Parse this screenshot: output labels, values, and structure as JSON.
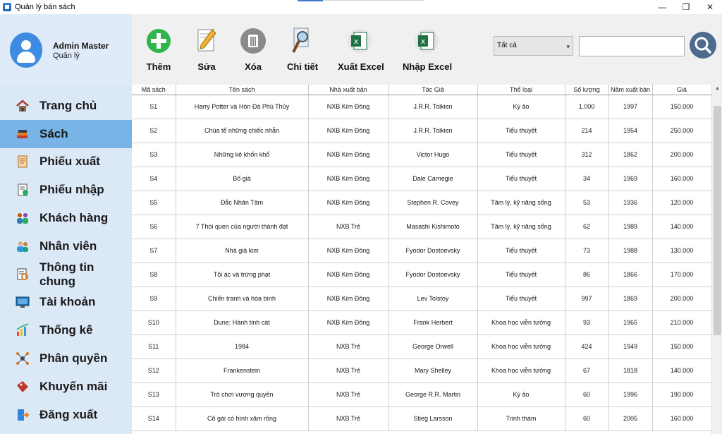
{
  "window": {
    "title": "Quản lý bán sách",
    "minimize": "—",
    "maximize": "❐",
    "close": "✕"
  },
  "profile": {
    "name": "Admin Master",
    "role": "Quản lý"
  },
  "nav": [
    {
      "label": "Trang chủ",
      "icon": "home-icon"
    },
    {
      "label": "Sách",
      "icon": "books-icon",
      "active": true
    },
    {
      "label": "Phiếu xuất",
      "icon": "export-receipt-icon"
    },
    {
      "label": "Phiếu nhập",
      "icon": "import-receipt-icon"
    },
    {
      "label": "Khách hàng",
      "icon": "customers-icon"
    },
    {
      "label": "Nhân viên",
      "icon": "employees-icon"
    },
    {
      "label": "Thông tin chung",
      "icon": "info-icon"
    },
    {
      "label": "Tài khoản",
      "icon": "account-icon"
    },
    {
      "label": "Thống kê",
      "icon": "statistics-icon"
    },
    {
      "label": "Phân quyền",
      "icon": "permissions-icon"
    },
    {
      "label": "Khuyến mãi",
      "icon": "promotion-icon"
    },
    {
      "label": "Đăng xuất",
      "icon": "logout-icon"
    }
  ],
  "toolbar": {
    "add": "Thêm",
    "edit": "Sửa",
    "delete": "Xóa",
    "detail": "Chi tiết",
    "export_excel": "Xuất Excel",
    "import_excel": "Nhập Excel"
  },
  "filter": {
    "selected": "Tất cả",
    "search_value": ""
  },
  "table": {
    "columns": [
      "Mã sách",
      "Tên sách",
      "Nhà xuất bản",
      "Tác Giả",
      "Thể loại",
      "Số lượng",
      "Năm xuất bản",
      "Giá"
    ],
    "rows": [
      [
        "S1",
        "Harry Potter và Hòn Đá Phù Thủy",
        "NXB Kim Đồng",
        "J.R.R. Tolkien",
        "Kỳ ảo",
        "1.000",
        "1997",
        "150.000"
      ],
      [
        "S2",
        "Chúa tể những chiếc nhẫn",
        "NXB Kim Đồng",
        "J.R.R. Tolkien",
        "Tiểu thuyết",
        "214",
        "1954",
        "250.000"
      ],
      [
        "S3",
        "Những kẻ khốn khổ",
        "NXB Kim Đồng",
        "Victor Hugo",
        "Tiểu thuyết",
        "312",
        "1862",
        "200.000"
      ],
      [
        "S4",
        "Bố già",
        "NXB Kim Đồng",
        "Dale Carnegie",
        "Tiểu thuyết",
        "34",
        "1969",
        "160.000"
      ],
      [
        "S5",
        "Đắc Nhân Tâm",
        "NXB Kim Đồng",
        "Stephen R. Covey",
        "Tâm lý, kỹ năng sống",
        "53",
        "1936",
        "120.000"
      ],
      [
        "S6",
        "7 Thói quen của người thành đạt",
        "NXB Trẻ",
        "Masashi Kishimoto",
        "Tâm lý, kỹ năng sống",
        "62",
        "1989",
        "140.000"
      ],
      [
        "S7",
        "Nhà giả kim",
        "NXB Kim Đồng",
        "Fyodor Dostoevsky",
        "Tiểu thuyết",
        "73",
        "1988",
        "130.000"
      ],
      [
        "S8",
        "Tội ác và trừng phạt",
        "NXB Kim Đồng",
        "Fyodor Dostoevsky",
        "Tiểu thuyết",
        "86",
        "1866",
        "170.000"
      ],
      [
        "S9",
        "Chiến tranh và hòa bình",
        "NXB Kim Đồng",
        "Lev Tolstoy",
        "Tiểu thuyết",
        "997",
        "1869",
        "200.000"
      ],
      [
        "S10",
        "Dune: Hành tinh cát",
        "NXB Kim Đồng",
        "Frank Herbert",
        "Khoa học viễn tưởng",
        "93",
        "1965",
        "210.000"
      ],
      [
        "S11",
        "1984",
        "NXB Trẻ",
        "George Orwell",
        "Khoa học viễn tưởng",
        "424",
        "1949",
        "150.000"
      ],
      [
        "S12",
        "Frankenstein",
        "NXB Trẻ",
        "Mary Shelley",
        "Khoa học viễn tưởng",
        "67",
        "1818",
        "140.000"
      ],
      [
        "S13",
        "Trò chơi vương quyền",
        "NXB Trẻ",
        "George R.R. Martin",
        "Kỳ ảo",
        "60",
        "1996",
        "190.000"
      ],
      [
        "S14",
        "Cô gái có hình xăm rồng",
        "NXB Trẻ",
        "Stieg Larsson",
        "Trinh thám",
        "60",
        "2005",
        "160.000"
      ]
    ]
  },
  "colors": {
    "sidebar_bg": "#dbe8f6",
    "active_item": "#78b4e6",
    "add_green": "#2fb64a",
    "excel_green": "#1e7145",
    "search_button": "#4f6b8c"
  }
}
